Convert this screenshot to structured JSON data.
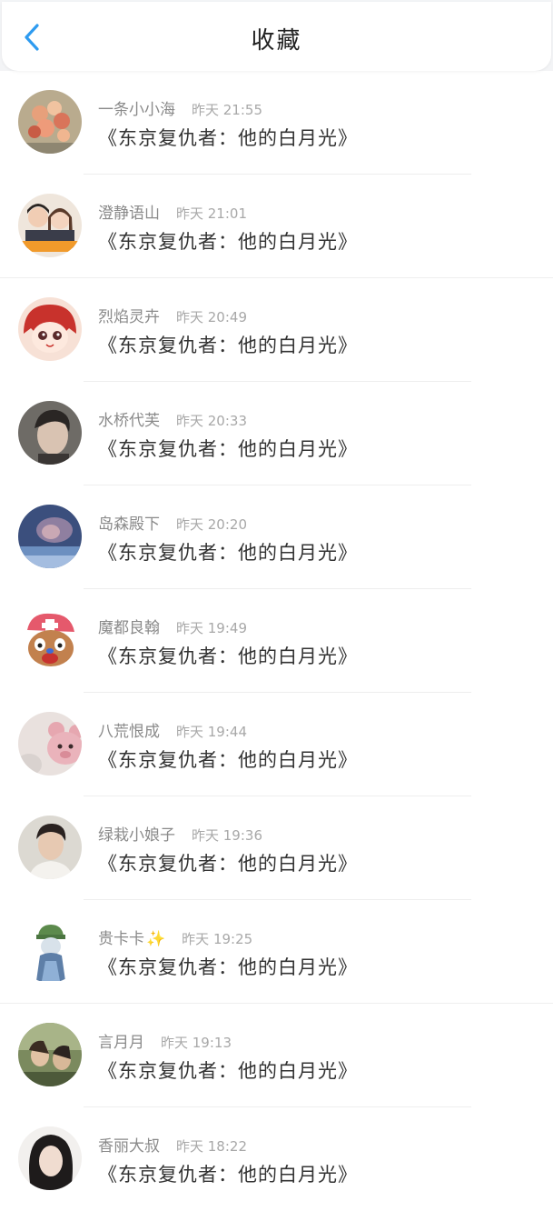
{
  "header": {
    "title": "收藏",
    "back_icon": "chevron-left-icon"
  },
  "colors": {
    "accent": "#2e9bf0",
    "name": "#8a8a8a",
    "time": "#a8a8a8"
  },
  "items": [
    {
      "name": "一条小小海",
      "time": "昨天 21:55",
      "content": "《东京复仇者：他的白月光》"
    },
    {
      "name": "澄静语山",
      "time": "昨天 21:01",
      "content": "《东京复仇者：他的白月光》"
    },
    {
      "name": "烈焰灵卉",
      "time": "昨天 20:49",
      "content": "《东京复仇者：他的白月光》"
    },
    {
      "name": "水桥代芙",
      "time": "昨天 20:33",
      "content": "《东京复仇者：他的白月光》"
    },
    {
      "name": "岛森殿下",
      "time": "昨天 20:20",
      "content": "《东京复仇者：他的白月光》"
    },
    {
      "name": "魔都良翰",
      "time": "昨天 19:49",
      "content": "《东京复仇者：他的白月光》"
    },
    {
      "name": "八荒恨成",
      "time": "昨天 19:44",
      "content": "《东京复仇者：他的白月光》"
    },
    {
      "name": "绿栽小娘子",
      "time": "昨天 19:36",
      "content": "《东京复仇者：他的白月光》"
    },
    {
      "name": "贵卡卡",
      "sparkle": "✨",
      "time": "昨天 19:25",
      "content": "《东京复仇者：他的白月光》"
    },
    {
      "name": "言月月",
      "time": "昨天 19:13",
      "content": "《东京复仇者：他的白月光》"
    },
    {
      "name": "香丽大叔",
      "time": "昨天 18:22",
      "content": "《东京复仇者：他的白月光》"
    }
  ]
}
